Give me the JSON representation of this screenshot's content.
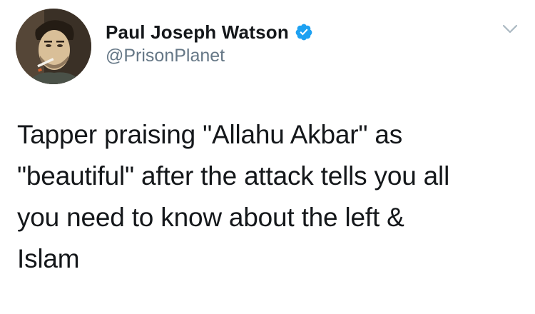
{
  "author": {
    "display_name": "Paul Joseph Watson",
    "handle": "@PrisonPlanet",
    "verified": true
  },
  "tweet": {
    "text": "Tapper praising \"Allahu Akbar\" as\n\"beautiful\" after the attack tells you all\nyou need to know about the left &\nIslam"
  },
  "icons": {
    "verified": "verified-badge-icon",
    "menu": "chevron-down-icon"
  },
  "colors": {
    "verified_blue": "#1da1f2",
    "handle_gray": "#657786",
    "text": "#14171a",
    "chevron_gray": "#aab8c2"
  }
}
